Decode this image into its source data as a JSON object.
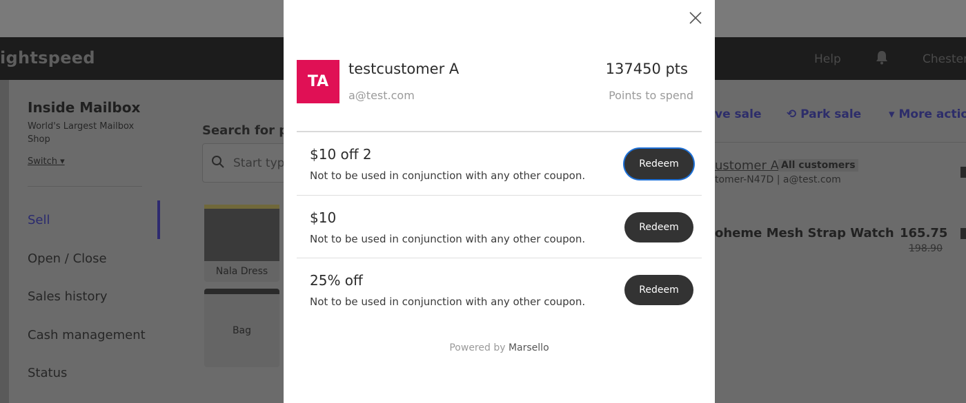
{
  "background": {
    "logo": "ightspeed",
    "nav": {
      "help": "Help",
      "user": "Chester"
    },
    "store": {
      "name": "Inside Mailbox",
      "subtitle": "World's Largest Mailbox Shop",
      "switch": "Switch"
    },
    "menu": [
      {
        "label": "Sell",
        "active": true
      },
      {
        "label": "Open / Close"
      },
      {
        "label": "Sales history"
      },
      {
        "label": "Cash management"
      },
      {
        "label": "Status"
      }
    ],
    "search": {
      "label": "Search for pr",
      "placeholder": "Start typ"
    },
    "products": [
      {
        "label": "Nala Dress"
      },
      {
        "label": "Bag"
      }
    ],
    "actions": {
      "save": "ve sale",
      "park": "Park sale",
      "more": "More actio"
    },
    "customer": {
      "name": "ustomer A",
      "tag": "All customers",
      "sub": "tomer-N47D | a@test.com"
    },
    "line_item": {
      "name": "oheme Mesh Strap Watch",
      "price": "165.75",
      "original": "198.90"
    }
  },
  "modal": {
    "avatar_initials": "TA",
    "customer_name": "testcustomer A",
    "customer_email": "a@test.com",
    "points": "137450 pts",
    "points_label": "Points to spend",
    "offers": [
      {
        "title": "$10 off 2",
        "description": "Not to be used in conjunction with any other coupon.",
        "button": "Redeem",
        "focused": true
      },
      {
        "title": "$10",
        "description": "Not to be used in conjunction with any other coupon.",
        "button": "Redeem"
      },
      {
        "title": "25% off",
        "description": "Not to be used in conjunction with any other coupon.",
        "button": "Redeem"
      }
    ],
    "powered_by": "Powered by",
    "brand": "Marsello"
  },
  "colors": {
    "avatar": "#e01055",
    "button": "#333333",
    "focus_ring": "#1c6fd6",
    "overlay": "#6b6b6b"
  }
}
